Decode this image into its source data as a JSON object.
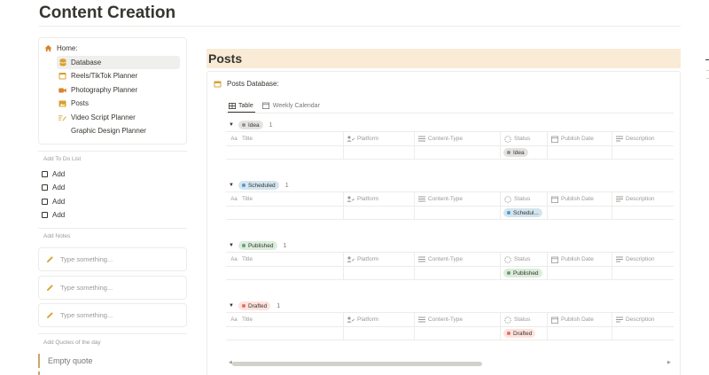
{
  "page": {
    "title": "Content Creation"
  },
  "nav": {
    "home_label": "Home:",
    "items": [
      {
        "label": "Database",
        "icon": "database-icon",
        "active": true
      },
      {
        "label": "Reels/TikTok Planner",
        "icon": "calendar-icon",
        "active": false
      },
      {
        "label": "Photography Planner",
        "icon": "video-camera-icon",
        "active": false
      },
      {
        "label": "Posts",
        "icon": "image-icon",
        "active": false
      },
      {
        "label": "Video Script Planner",
        "icon": "script-icon",
        "active": false
      },
      {
        "label": "Graphic Design Planner",
        "icon": "",
        "active": false
      }
    ]
  },
  "todo": {
    "label": "Add To Do List",
    "items": [
      "Add",
      "Add",
      "Add",
      "Add"
    ]
  },
  "notes": {
    "label": "Add Notes",
    "placeholder": "Type something..."
  },
  "quotes": {
    "label": "Add Quotes of the day",
    "placeholder": "Empty quote"
  },
  "posts": {
    "banner": "Posts",
    "db_title": "Posts Database:",
    "tabs": [
      {
        "label": "Table",
        "active": true
      },
      {
        "label": "Weekly Calendar",
        "active": false
      }
    ],
    "columns": [
      "Title",
      "Platform",
      "Content-Type",
      "Status",
      "Publish Date",
      "Description"
    ],
    "title_prefix": "Aa",
    "groups": [
      {
        "label": "Idea",
        "count": "1",
        "status": "Idea",
        "bg": "#e3e2e0",
        "dot": "#91918e"
      },
      {
        "label": "Scheduled",
        "count": "1",
        "status": "Schedul...",
        "bg": "#d3e5ef",
        "dot": "#5a96c8"
      },
      {
        "label": "Published",
        "count": "1",
        "status": "Published",
        "bg": "#dbeddb",
        "dot": "#6c9b7d"
      },
      {
        "label": "Drafted",
        "count": "1",
        "status": "Drafted",
        "bg": "#ffe2dd",
        "dot": "#d9736b"
      }
    ]
  },
  "colors": {
    "accent": "#c8a86a",
    "banner": "#faebd7"
  }
}
